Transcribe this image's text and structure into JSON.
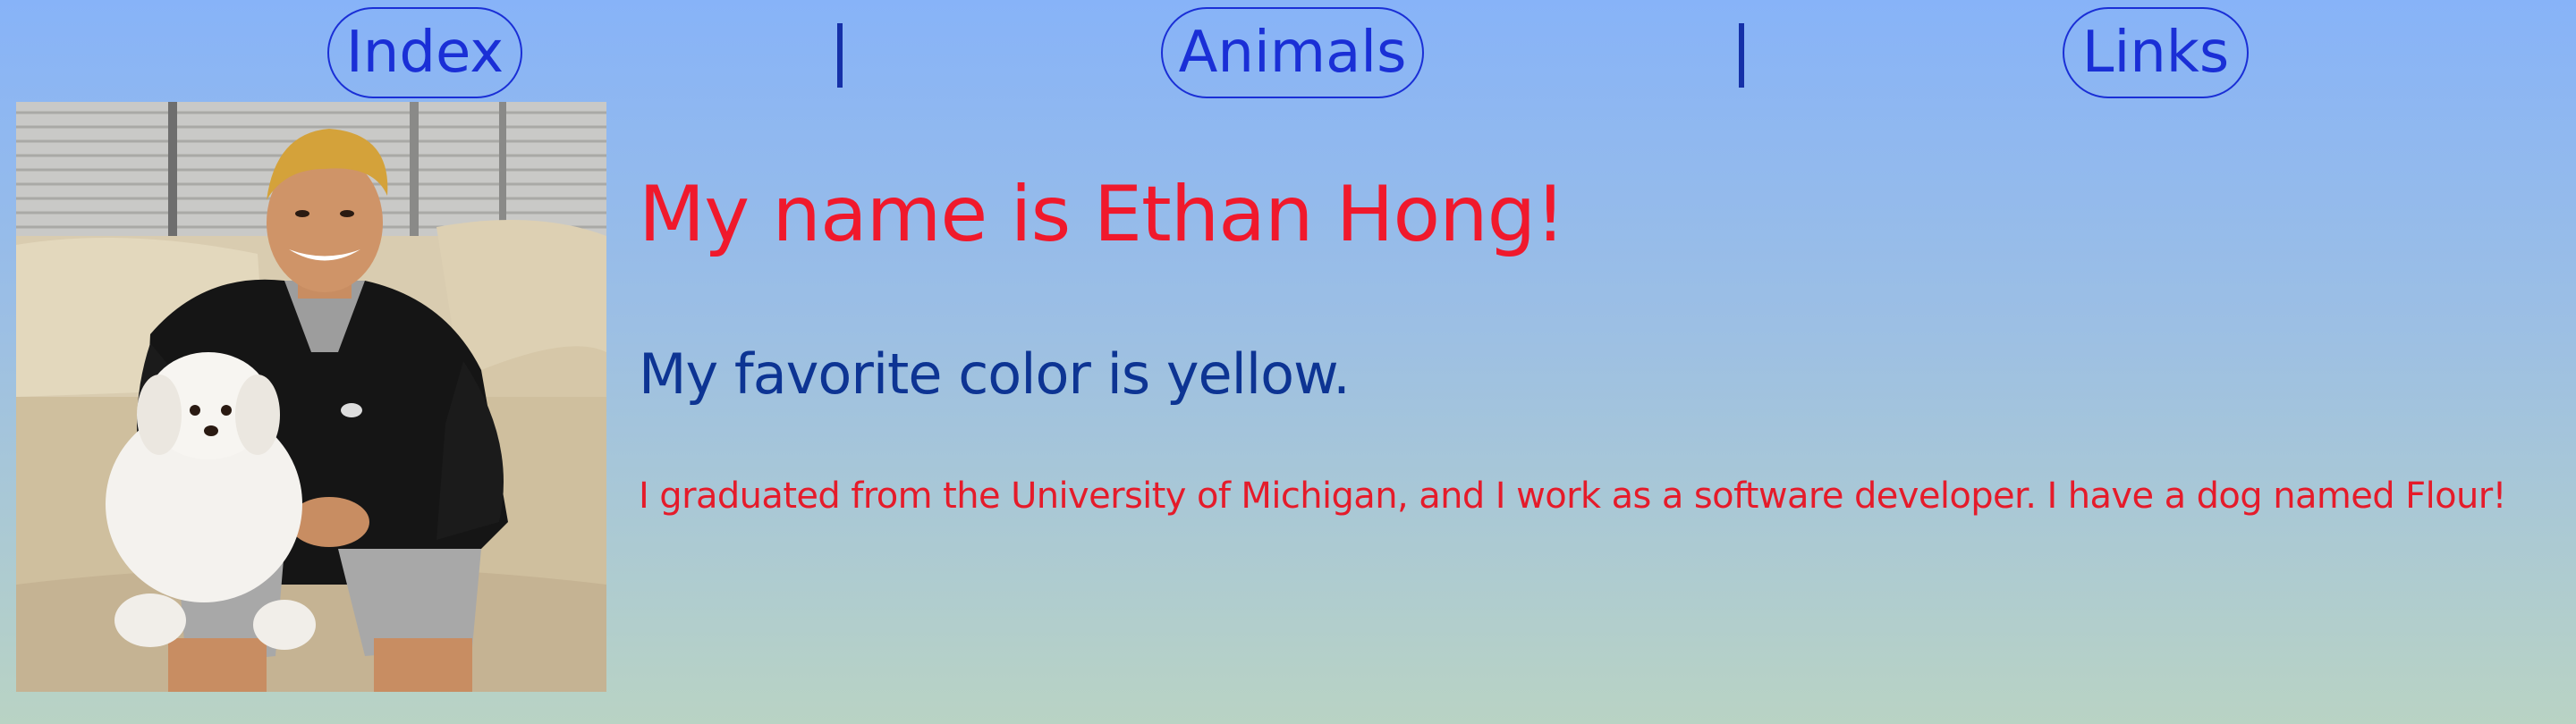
{
  "nav": {
    "items": [
      {
        "label": "Index"
      },
      {
        "label": "Animals"
      },
      {
        "label": "Links"
      }
    ],
    "separator": "|"
  },
  "profile": {
    "photo_alt": "Ethan Hong sitting on a couch holding his white dog Flour",
    "heading": "My name is Ethan Hong!",
    "subheading": "My favorite color is yellow.",
    "bio": "I graduated from the University of Michigan, and I work as a software developer. I have a dog named Flour!"
  },
  "colors": {
    "background_top": "#87b3f8",
    "background_bottom": "#b9d3c4",
    "nav_link": "#1a2fd6",
    "heading": "#f0192c",
    "subheading": "#0d3493",
    "bio": "#e51b2a"
  }
}
